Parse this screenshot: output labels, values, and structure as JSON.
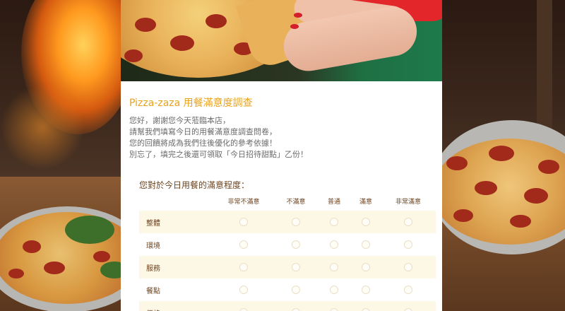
{
  "survey": {
    "title": "Pizza-zaza 用餐滿意度調查",
    "intro": [
      "您好，謝謝您今天蒞臨本店，",
      "請幫我們填寫今日的用餐滿意度調查問卷，",
      "您的回饋將成為我們往後優化的參考依據！",
      "別忘了，填完之後還可領取「今日招待甜點」乙份！"
    ],
    "question": "您對於今日用餐的滿意程度："
  },
  "matrix": {
    "columns": [
      "非常不滿意",
      "不滿意",
      "普通",
      "滿意",
      "非常滿意"
    ],
    "rows": [
      "整體",
      "環境",
      "服務",
      "餐點",
      "價格"
    ]
  },
  "colors": {
    "accent": "#e8a31d",
    "label": "#6d4420",
    "row_alt": "#fdf7e6"
  }
}
